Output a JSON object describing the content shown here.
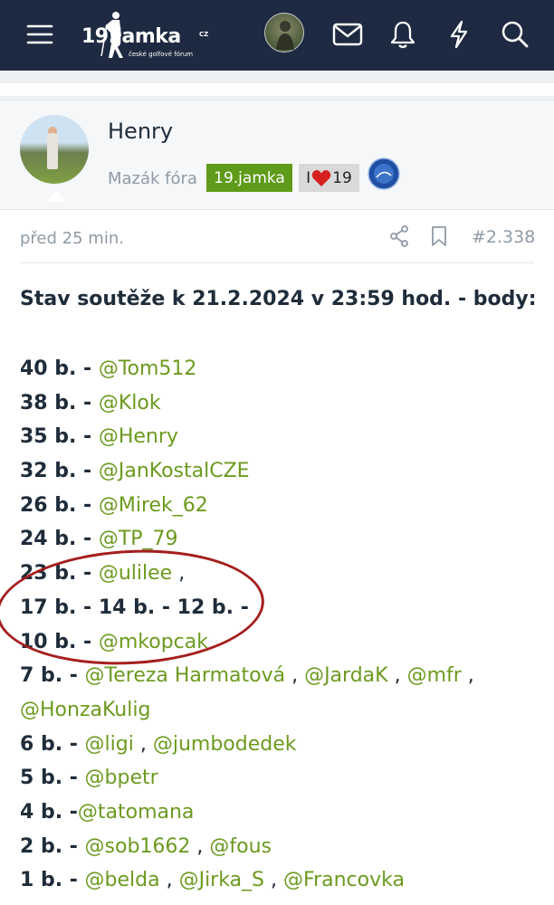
{
  "header": {
    "logo_text": "19.jamka",
    "logo_cz": "CZ",
    "logo_sub": "české golfové fórum"
  },
  "post": {
    "author": "Henry",
    "user_title": "Mazák fóra",
    "badge_group": "19.jamka",
    "badge_love_prefix": "I",
    "badge_love_suffix": "19",
    "time": "před 25 min.",
    "post_number": "#2.338",
    "heading": "Stav soutěže k 21.2.2024 v 23:59 hod. - body:",
    "lines": [
      {
        "points": "40 b. - ",
        "mentions": [
          "@Tom512"
        ],
        "trailing": ""
      },
      {
        "points": "38 b. - ",
        "mentions": [
          "@Klok"
        ],
        "trailing": ""
      },
      {
        "points": "35 b. - ",
        "mentions": [
          "@Henry"
        ],
        "trailing": ""
      },
      {
        "points": "32 b. - ",
        "mentions": [
          "@JanKostalCZE"
        ],
        "trailing": ""
      },
      {
        "points": "26 b. - ",
        "mentions": [
          "@Mirek_62"
        ],
        "trailing": ""
      },
      {
        "points": "24 b. - ",
        "mentions": [
          "@TP_79"
        ],
        "trailing": ""
      },
      {
        "points": "23 b. - ",
        "mentions": [
          "@ulilee"
        ],
        "trailing": " ,"
      },
      {
        "points": "17 b. - 14 b. - 12 b. -",
        "mentions": [],
        "trailing": ""
      },
      {
        "points": "10 b. - ",
        "mentions": [
          "@mkopcak"
        ],
        "trailing": ""
      },
      {
        "points": "7 b. - ",
        "mentions": [
          "@Tereza Harmatová",
          "@JardaK",
          "@mfr"
        ],
        "trailing": " ,"
      },
      {
        "points": "",
        "mentions": [
          "@HonzaKulig"
        ],
        "trailing": ""
      },
      {
        "points": "6 b. - ",
        "mentions": [
          "@ligi",
          "@jumbodedek"
        ],
        "trailing": ""
      },
      {
        "points": "5 b. - ",
        "mentions": [
          "@bpetr"
        ],
        "trailing": ""
      },
      {
        "points": "4 b. -",
        "mentions": [
          "@tatomana"
        ],
        "trailing": ""
      },
      {
        "points": "2 b. - ",
        "mentions": [
          "@sob1662",
          "@fous"
        ],
        "trailing": ""
      },
      {
        "points": "1 b. - ",
        "mentions": [
          "@belda",
          "@Jirka_S",
          "@Francovka"
        ],
        "trailing": ""
      }
    ]
  },
  "colors": {
    "header_bg": "#1d2a41",
    "mention": "#6c9a1f",
    "badge_green": "#5f9b1a",
    "annotation": "#a51e1e"
  },
  "icons": [
    "menu-icon",
    "mail-icon",
    "bell-icon",
    "bolt-icon",
    "search-icon",
    "share-icon",
    "bookmark-icon",
    "heart-icon"
  ]
}
